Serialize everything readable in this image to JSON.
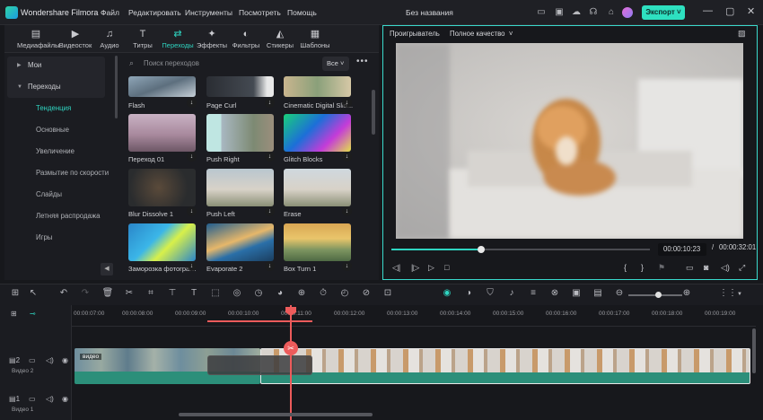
{
  "titlebar": {
    "app_name": "Wondershare Filmora",
    "menu": [
      "Файл",
      "Редактировать",
      "Инструменты",
      "Посмотреть",
      "Помощь"
    ],
    "document_title": "Без названия",
    "export_label": "Экспорт",
    "icons": [
      "monitor-icon",
      "save-icon",
      "cloud-icon",
      "headset-icon",
      "gift-icon",
      "grid-icon"
    ]
  },
  "media_tabs": [
    {
      "label": "Медиафайлы",
      "icon": "media-icon"
    },
    {
      "label": "Видеосток",
      "icon": "stock-video-icon"
    },
    {
      "label": "Аудио",
      "icon": "music-icon"
    },
    {
      "label": "Титры",
      "icon": "title-icon"
    },
    {
      "label": "Переходы",
      "icon": "transition-icon"
    },
    {
      "label": "Эффекты",
      "icon": "effects-icon"
    },
    {
      "label": "Фильтры",
      "icon": "filter-icon"
    },
    {
      "label": "Стикеры",
      "icon": "sticker-icon"
    },
    {
      "label": "Шаблоны",
      "icon": "template-icon"
    }
  ],
  "categories": {
    "mine": "Мои",
    "transitions": "Переходы",
    "items": [
      "Тенденция",
      "Основные",
      "Увеличение",
      "Размытие по скорости",
      "Слайды",
      "Летняя распродажа",
      "Игры"
    ]
  },
  "search": {
    "placeholder": "Поиск переходов",
    "filter": "Все"
  },
  "transitions": [
    "Flash",
    "Page Curl",
    "Cinematic Digital Slid...",
    "Переход 01",
    "Push Right",
    "Glitch Blocks",
    "Blur Dissolve 1",
    "Push Left",
    "Erase",
    "Заморозка фотограф...",
    "Evaporate 2",
    "Box Turn 1"
  ],
  "player": {
    "label": "Проигрыватель",
    "quality": "Полное качество",
    "current_time": "00:00:10:23",
    "separator": "/",
    "total_time": "00:00:32:01",
    "progress": 0.347
  },
  "timeline": {
    "ruler": [
      "00:00:07:00",
      "00:00:08:00",
      "00:00:09:00",
      "00:00:10:00",
      "00:00:11:00",
      "00:00:12:00",
      "00:00:13:00",
      "00:00:14:00",
      "00:00:15:00",
      "00:00:16:00",
      "00:00:17:00",
      "00:00:18:00",
      "00:00:19:00"
    ],
    "track2_label": "Видео 2",
    "track1_label": "Видео 1",
    "track2_num": "2",
    "track1_num": "1",
    "clip_label": "видео",
    "zoom": 0.55
  },
  "colors": {
    "accent": "#2fd6c2",
    "export": "#2ee0c0",
    "playhead": "#ec5b5b",
    "clip": "#2c8f7a"
  }
}
